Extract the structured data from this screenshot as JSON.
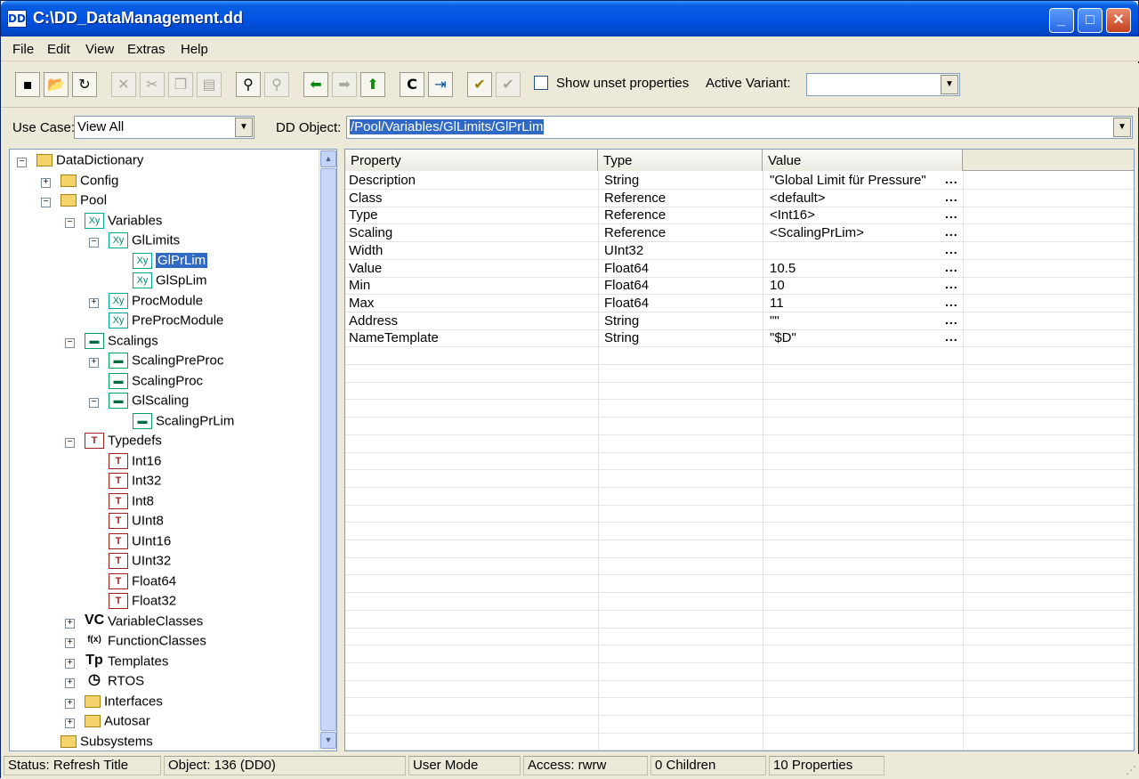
{
  "window": {
    "title": "C:\\DD_DataManagement.dd",
    "icon_text": "DD"
  },
  "menu": [
    "File",
    "Edit",
    "View",
    "Extras",
    "Help"
  ],
  "toolbar": {
    "show_unset_label": "Show unset properties",
    "show_unset_checked": false,
    "active_variant_label": "Active Variant:",
    "active_variant_value": ""
  },
  "usecase": {
    "label": "Use Case:",
    "value": "View All"
  },
  "ddobject": {
    "label": "DD Object:",
    "value": "/Pool/Variables/GlLimits/GlPrLim"
  },
  "tree": [
    {
      "label": "DataDictionary",
      "icon": "folder-icon"
    },
    {
      "label": "Config",
      "icon": "folder-icon"
    },
    {
      "label": "Pool",
      "icon": "folder-icon"
    },
    {
      "label": "Variables",
      "icon": "variable-icon"
    },
    {
      "label": "GlLimits",
      "icon": "variable-icon"
    },
    {
      "label": "GlPrLim",
      "icon": "variable-icon",
      "selected": true
    },
    {
      "label": "GlSpLim",
      "icon": "variable-icon"
    },
    {
      "label": "ProcModule",
      "icon": "variable-icon"
    },
    {
      "label": "PreProcModule",
      "icon": "variable-icon"
    },
    {
      "label": "Scalings",
      "icon": "scaling-icon"
    },
    {
      "label": "ScalingPreProc",
      "icon": "scaling-icon"
    },
    {
      "label": "ScalingProc",
      "icon": "scaling-icon"
    },
    {
      "label": "GlScaling",
      "icon": "scaling-icon"
    },
    {
      "label": "ScalingPrLim",
      "icon": "scaling-icon"
    },
    {
      "label": "Typedefs",
      "icon": "typedef-icon"
    },
    {
      "label": "Int16",
      "icon": "typedef-icon"
    },
    {
      "label": "Int32",
      "icon": "typedef-icon"
    },
    {
      "label": "Int8",
      "icon": "typedef-icon"
    },
    {
      "label": "UInt8",
      "icon": "typedef-icon"
    },
    {
      "label": "UInt16",
      "icon": "typedef-icon"
    },
    {
      "label": "UInt32",
      "icon": "typedef-icon"
    },
    {
      "label": "Float64",
      "icon": "typedef-icon"
    },
    {
      "label": "Float32",
      "icon": "typedef-icon"
    },
    {
      "label": "VariableClasses",
      "icon": "variable-class-icon"
    },
    {
      "label": "FunctionClasses",
      "icon": "function-class-icon"
    },
    {
      "label": "Templates",
      "icon": "template-icon"
    },
    {
      "label": "RTOS",
      "icon": "rtos-icon"
    },
    {
      "label": "Interfaces",
      "icon": "folder-icon"
    },
    {
      "label": "Autosar",
      "icon": "folder-icon"
    },
    {
      "label": "Subsystems",
      "icon": "folder-icon"
    }
  ],
  "grid": {
    "columns": [
      "Property",
      "Type",
      "Value"
    ],
    "rows": [
      {
        "property": "Description",
        "type": "String",
        "value": "\"Global Limit für Pressure\""
      },
      {
        "property": "Class",
        "type": "Reference",
        "value": "<default>"
      },
      {
        "property": "Type",
        "type": "Reference",
        "value": "<Int16>"
      },
      {
        "property": "Scaling",
        "type": "Reference",
        "value": "<ScalingPrLim>"
      },
      {
        "property": "Width",
        "type": "UInt32",
        "value": ""
      },
      {
        "property": "Value",
        "type": "Float64",
        "value": "10.5"
      },
      {
        "property": "Min",
        "type": "Float64",
        "value": "10"
      },
      {
        "property": "Max",
        "type": "Float64",
        "value": "11"
      },
      {
        "property": "Address",
        "type": "String",
        "value": "\"\""
      },
      {
        "property": "NameTemplate",
        "type": "String",
        "value": "\"$D\""
      }
    ],
    "edit_button": "..."
  },
  "status": {
    "status": "Status: Refresh Title",
    "object": "Object: 136 (DD0)",
    "mode": "User Mode",
    "access": "Access: rwrw",
    "children": "0 Children",
    "properties": "10 Properties"
  }
}
